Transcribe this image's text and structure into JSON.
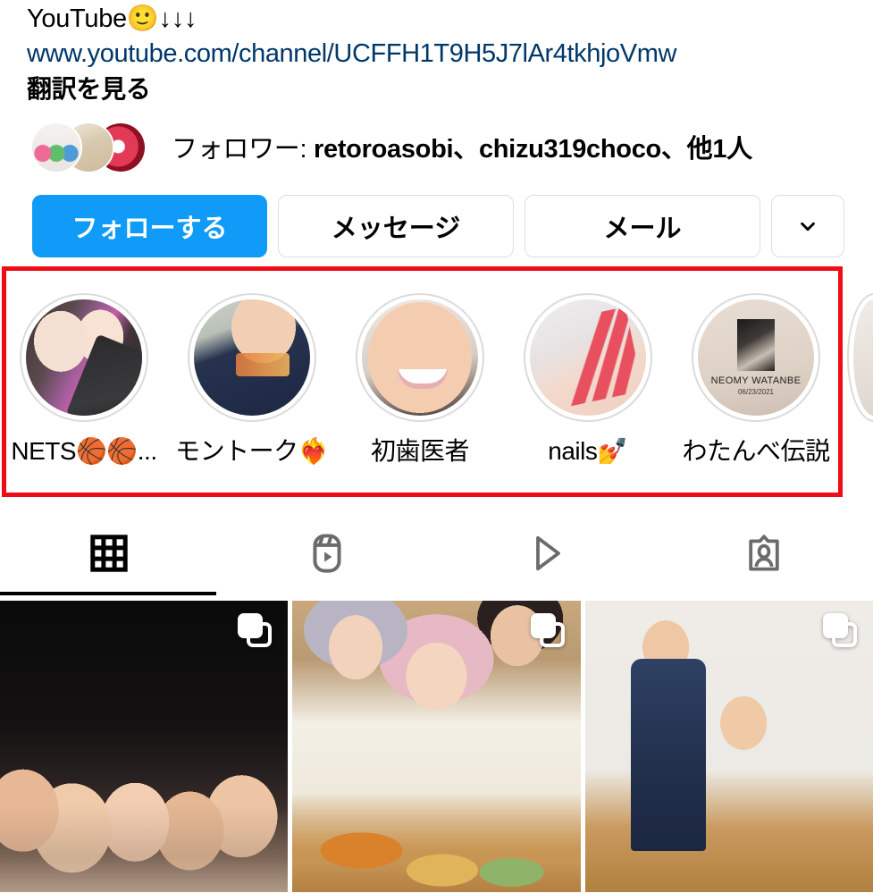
{
  "bio": {
    "title": "YouTube🙂↓↓↓",
    "link": "www.youtube.com/channel/UCFFH1T9H5J7lAr4tkhjoVmw",
    "translate": "翻訳を見る"
  },
  "followers": {
    "label": "フォロワー: ",
    "names": "retoroasobi、chizu319choco、他1人",
    "avatars": [
      "retro-toys-avatar",
      "craft-avatar",
      "red-umbrella-avatar"
    ]
  },
  "actions": {
    "follow": "フォローする",
    "message": "メッセージ",
    "email": "メール",
    "more_icon": "chevron-down-icon",
    "follow_color": "#0f9bf7"
  },
  "highlights": {
    "annotation_color": "#f00b16",
    "items": [
      {
        "label": "NETS🏀🏀...",
        "thumb": "nets-couple-thumb"
      },
      {
        "label": "モントーク❤️‍🔥",
        "thumb": "montauk-tee-thumb"
      },
      {
        "label": "初歯医者",
        "thumb": "dentist-selfie-thumb"
      },
      {
        "label": "nails💅",
        "thumb": "nails-thumb"
      },
      {
        "label": "わたんべ伝説",
        "thumb": "neomy-watanbe-thumb",
        "card_name": "NEOMY WATANBE",
        "card_date": "06/23/2021"
      }
    ]
  },
  "tabs": {
    "active_index": 0,
    "items": [
      {
        "name": "grid-tab",
        "icon": "grid-icon"
      },
      {
        "name": "reels-tab",
        "icon": "reels-icon"
      },
      {
        "name": "igtv-tab",
        "icon": "play-triangle-icon"
      },
      {
        "name": "tagged-tab",
        "icon": "tagged-person-icon"
      }
    ]
  },
  "posts": [
    {
      "alt": "group-photo-dark-room",
      "badge": "carousel-icon"
    },
    {
      "alt": "saizeriya-fashion-shoot",
      "badge": "carousel-icon"
    },
    {
      "alt": "overalls-birthday-cake",
      "badge": "carousel-icon"
    }
  ]
}
